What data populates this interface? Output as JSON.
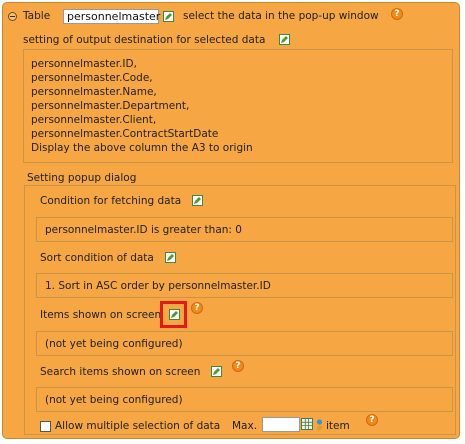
{
  "header": {
    "prefix": "Table",
    "table_name": "personnelmaster",
    "suffix": "select the data in the pop-up window"
  },
  "output_destination": {
    "label": "setting of output destination for selected data",
    "lines": [
      "personnelmaster.ID,",
      "personnelmaster.Code,",
      "personnelmaster.Name,",
      "personnelmaster.Department,",
      "personnelmaster.Client,",
      "personnelmaster.ContractStartDate",
      "Display the above column the A3 to origin"
    ]
  },
  "popup": {
    "label": "Setting popup dialog",
    "fetch_condition": {
      "label": "Condition for fetching data",
      "value": "personnelmaster.ID is greater than: 0"
    },
    "sort_condition": {
      "label": "Sort condition of data",
      "value": "1. Sort in ASC order by personnelmaster.ID"
    },
    "items_shown": {
      "label": "Items shown on screen",
      "value": "(not yet being configured)"
    },
    "search_items": {
      "label": "Search items shown on screen",
      "value": "(not yet being configured)"
    },
    "multi_select": {
      "label": "Allow multiple selection of data",
      "checked": false,
      "max_label": "Max.",
      "max_value": "",
      "unit_label": "item"
    }
  },
  "icons": {
    "edit": "edit-icon",
    "help": "help-icon",
    "collapse": "collapse-icon"
  },
  "colors": {
    "panel_bg": "#f6a743",
    "highlight": "#e11b1b",
    "help": "#f08a1c"
  }
}
